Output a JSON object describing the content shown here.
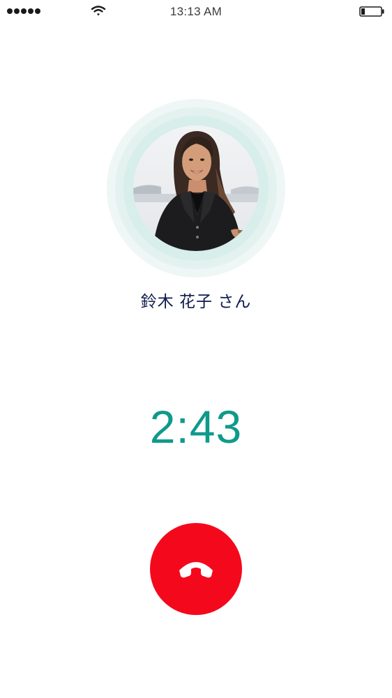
{
  "status_bar": {
    "signal_icon": "signal-dots-icon",
    "wifi_icon": "wifi-icon",
    "time": "13:13 AM",
    "battery_icon": "battery-low-icon"
  },
  "caller": {
    "avatar_icon": "caller-photo",
    "name": "鈴木 花子 さん"
  },
  "call": {
    "duration": "2:43",
    "end_call_icon": "phone-hangup-icon"
  },
  "colors": {
    "accent": "#0f9a8a",
    "end_call": "#f4091c",
    "name_text": "#0d1a4a",
    "ring_light": "#eef7f5"
  }
}
